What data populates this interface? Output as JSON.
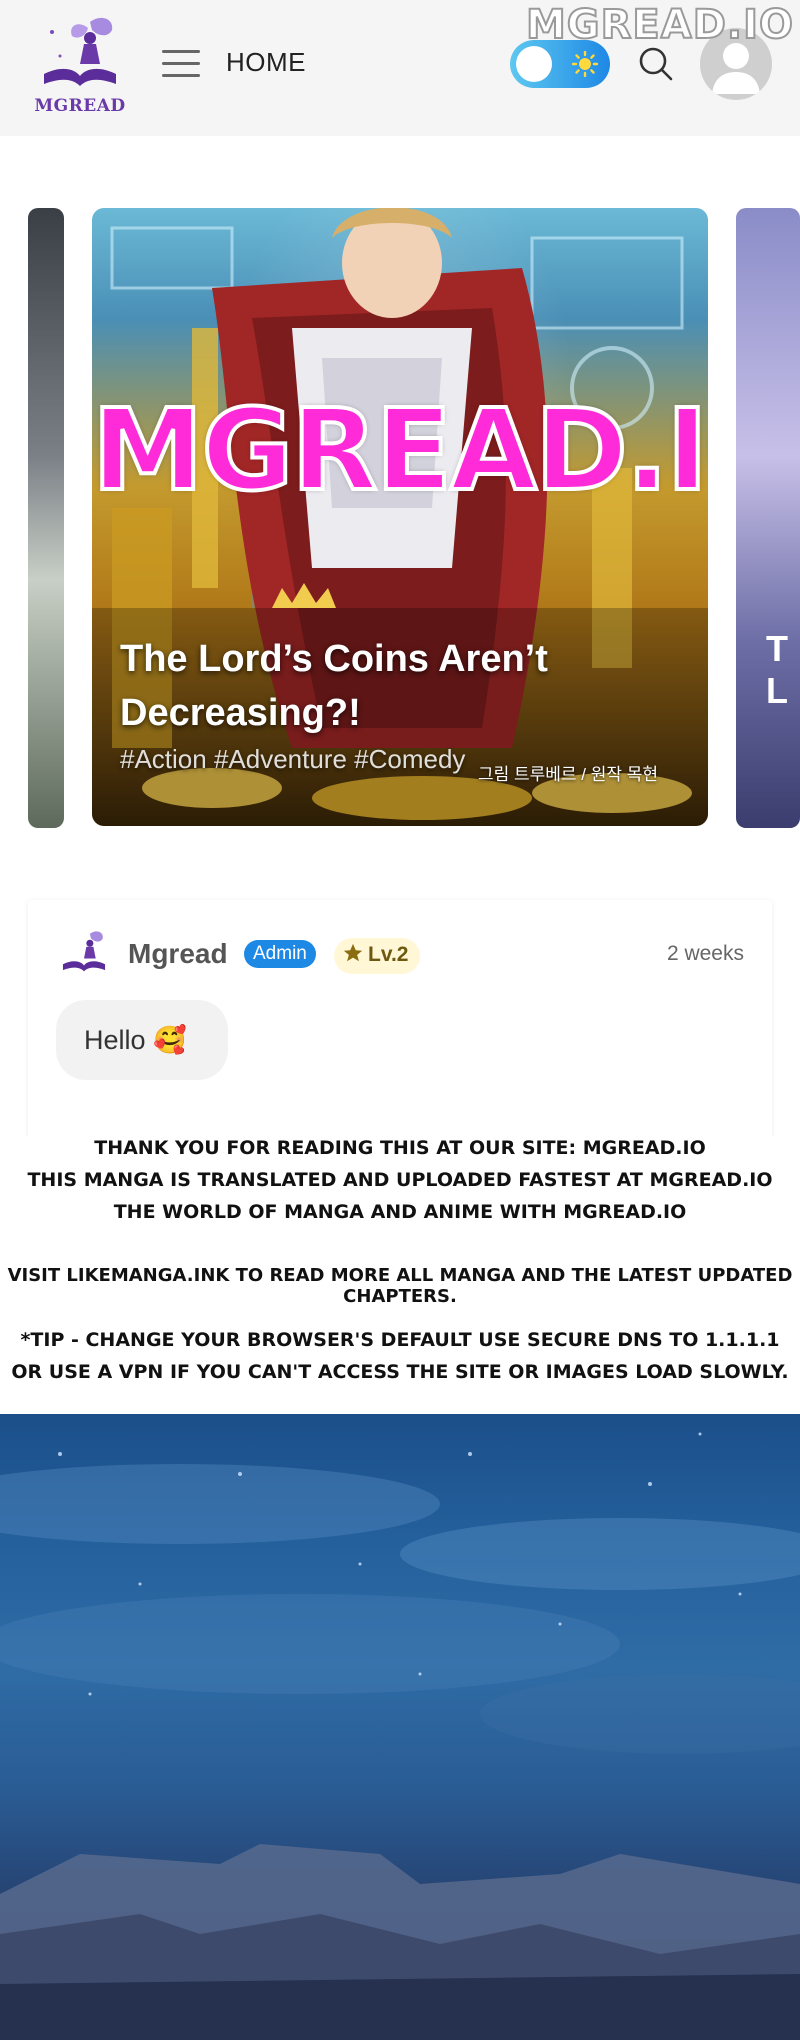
{
  "watermark": "MGREAD.IO",
  "header": {
    "logo_text": "MGREAD",
    "nav_home": "HOME"
  },
  "carousel": {
    "brand_overlay": "MGREAD.IO",
    "title": "The Lord’s Coins Aren’t Decreasing?!",
    "tags": "#Action #Adventure #Comedy",
    "credit": "그림 트루베르 / 원작 목현",
    "next_card_peek": "T L"
  },
  "comment": {
    "author": "Mgread",
    "admin_badge": "Admin",
    "level_badge": "Lv.2",
    "time": "2 weeks",
    "message": "Hello 🥰"
  },
  "notice": {
    "lines": [
      "THANK YOU FOR READING THIS AT OUR SITE: MGREAD.IO",
      "THIS MANGA IS TRANSLATED AND UPLOADED FASTEST AT MGREAD.IO",
      "THE WORLD OF MANGA AND ANIME WITH MGREAD.IO",
      "VISIT LIKEMANGA.INK TO READ MORE ALL MANGA AND THE LATEST UPDATED CHAPTERS.",
      "*TIP - CHANGE YOUR BROWSER'S DEFAULT USE SECURE DNS TO 1.1.1.1",
      "OR USE A VPN IF YOU CAN'T ACCESS THE SITE OR IMAGES LOAD SLOWLY."
    ]
  },
  "colors": {
    "brand_purple": "#6a3aa8",
    "overlay_magenta": "#ff2bd9",
    "admin_blue": "#1e88e5",
    "toggle_gradient_start": "#5ec8f0"
  },
  "icons": {
    "menu": "hamburger-icon",
    "search": "search-icon",
    "toggle": "sun-icon",
    "avatar": "user-icon",
    "level": "star-icon"
  }
}
